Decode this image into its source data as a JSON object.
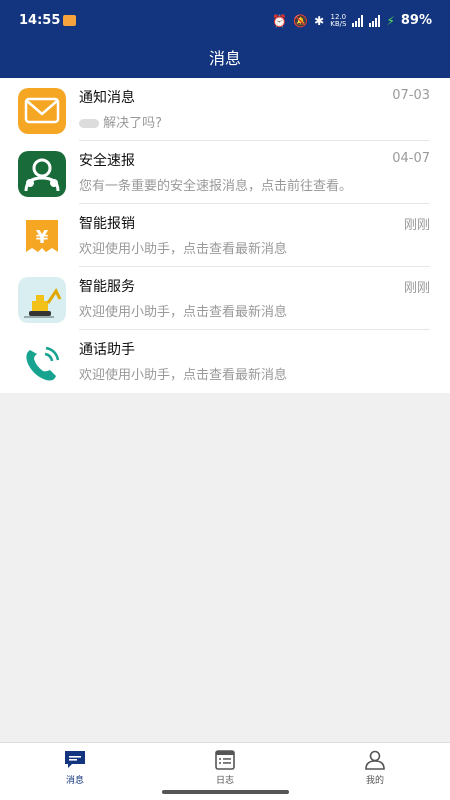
{
  "status_bar": {
    "time": "14:55",
    "speed": "12.0",
    "speed_unit": "KB/S",
    "battery": "89%"
  },
  "header": {
    "title": "消息"
  },
  "messages": [
    {
      "title": "通知消息",
      "time": "07-03",
      "preview": "解决了吗?",
      "icon": "envelope-icon"
    },
    {
      "title": "安全速报",
      "time": "04-07",
      "preview": "您有一条重要的安全速报消息，点击前往查看。",
      "icon": "safety-person-icon"
    },
    {
      "title": "智能报销",
      "time": "刚刚",
      "preview": "欢迎使用小助手，点击查看最新消息",
      "icon": "yen-receipt-icon"
    },
    {
      "title": "智能服务",
      "time": "刚刚",
      "preview": "欢迎使用小助手，点击查看最新消息",
      "icon": "excavator-icon"
    },
    {
      "title": "通话助手",
      "time": "",
      "preview": "欢迎使用小助手，点击查看最新消息",
      "icon": "phone-call-icon"
    }
  ],
  "tabs": [
    {
      "label": "消息",
      "icon": "message-icon",
      "active": true
    },
    {
      "label": "日志",
      "icon": "log-icon",
      "active": false
    },
    {
      "label": "我的",
      "icon": "profile-icon",
      "active": false
    }
  ],
  "colors": {
    "header_bg": "#13357f",
    "accent_orange": "#f5a623",
    "safety_green": "#1a6b3a",
    "phone_teal": "#17a38f"
  }
}
